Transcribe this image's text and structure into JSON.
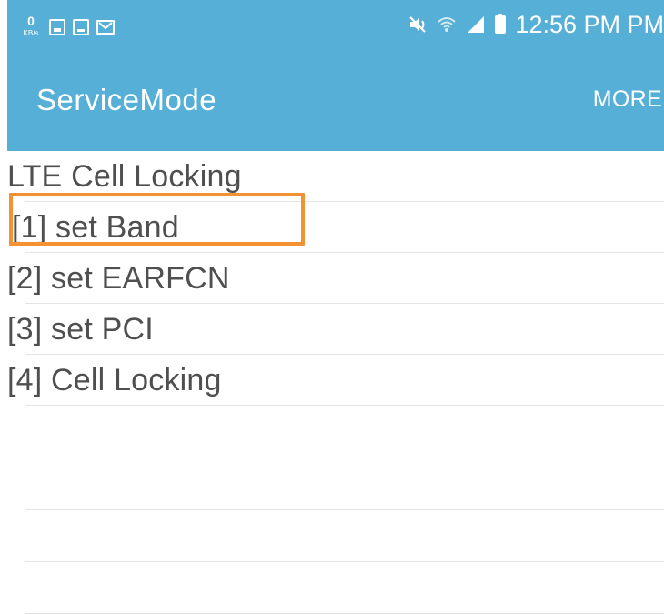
{
  "status_bar": {
    "kbs_value": "0",
    "kbs_unit": "KB/s",
    "left_icons": [
      "data-speed-icon",
      "gallery-icon",
      "screen-icon",
      "mail-icon"
    ],
    "right_icons": [
      "mute-icon",
      "wifi-icon",
      "signal-icon",
      "battery-icon"
    ],
    "time": "12:56 PM PM"
  },
  "app_bar": {
    "title": "ServiceMode",
    "more_label": "MORE"
  },
  "list": {
    "items": [
      "LTE Cell Locking",
      "[1] set Band",
      "[2] set EARFCN",
      "[3] set PCI",
      "[4] Cell Locking"
    ]
  },
  "colors": {
    "header_blue": "#55afd6",
    "highlight_orange": "#f39233",
    "text_gray": "#4f4f4f"
  },
  "highlight": {
    "target_item": "[1] set Band"
  }
}
